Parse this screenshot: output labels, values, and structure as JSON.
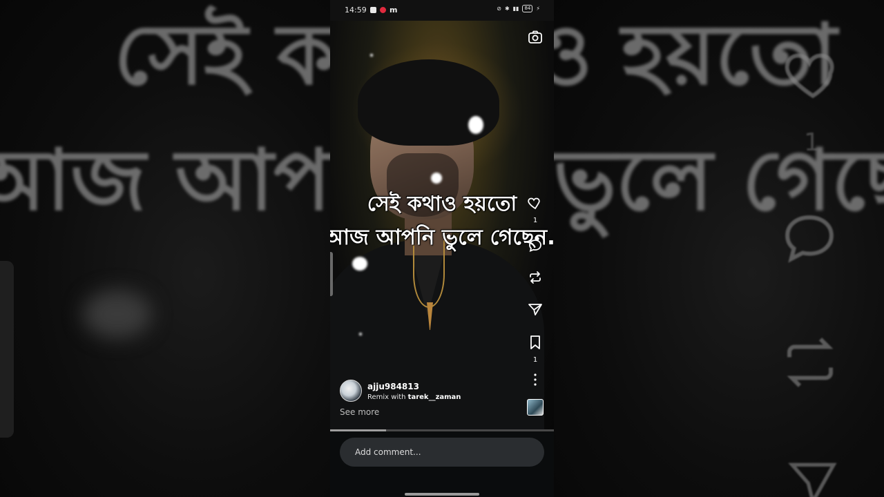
{
  "status_bar": {
    "time": "14:59",
    "battery": "84",
    "app_icons": [
      "facebook-icon",
      "youtube-icon",
      "messenger-icon"
    ]
  },
  "video": {
    "caption_line1": "সেই কথাও হয়তো",
    "caption_line2": "আজ আপনি ভুলে গেছেন.",
    "progress_percent": 25
  },
  "actions": {
    "like_count": "1",
    "comment_count": "",
    "bookmark_count": "1"
  },
  "author": {
    "username": "ajju984813",
    "remix_prefix": "Remix with",
    "remix_user": "tarek__zaman"
  },
  "see_more": "See more",
  "comment": {
    "placeholder": "Add comment..."
  },
  "colors": {
    "background": "#0a0c0d",
    "comment_bar": "#2a2d30",
    "progress_track": "#474747",
    "progress_fill": "#9e9e9e"
  }
}
